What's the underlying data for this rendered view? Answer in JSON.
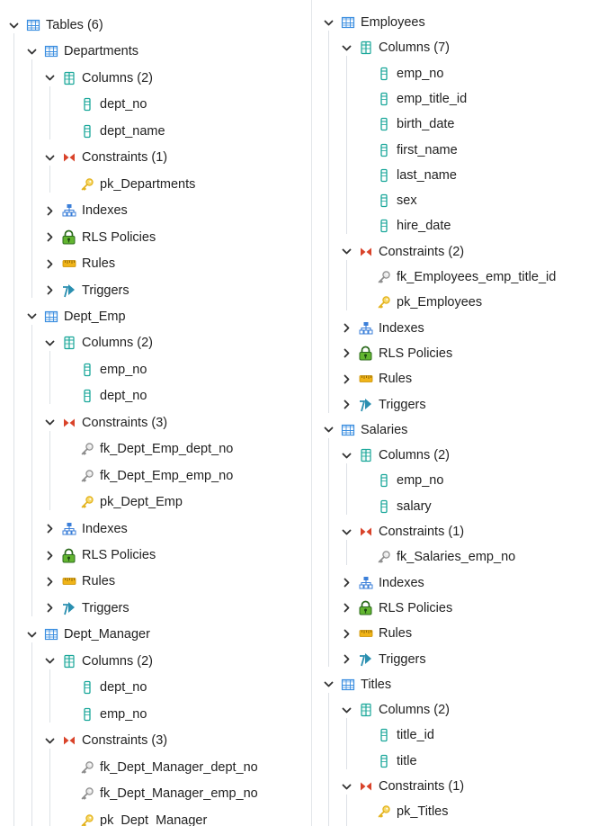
{
  "icon_colors": {
    "table": "#3b8ee0",
    "column": "#1aa79a",
    "constraint": "#d9432a",
    "pk_key": "#e3b21c",
    "fk_key": "#8c8c8c",
    "index": "#3b7fd9",
    "rls": "#3a9a28",
    "rules": "#f0b419",
    "triggers": "#2a8fb0"
  },
  "left": [
    {
      "label": "Tables (6)",
      "level": 0,
      "icon": "table",
      "chevron": "down"
    },
    {
      "label": "Departments",
      "level": 1,
      "icon": "table",
      "chevron": "down"
    },
    {
      "label": "Columns (2)",
      "level": 2,
      "icon": "columns",
      "chevron": "down"
    },
    {
      "label": "dept_no",
      "level": 3,
      "icon": "column",
      "chevron": "none"
    },
    {
      "label": "dept_name",
      "level": 3,
      "icon": "column",
      "chevron": "none"
    },
    {
      "label": "Constraints (1)",
      "level": 2,
      "icon": "constraints",
      "chevron": "down"
    },
    {
      "label": "pk_Departments",
      "level": 3,
      "icon": "pk",
      "chevron": "none"
    },
    {
      "label": "Indexes",
      "level": 2,
      "icon": "indexes",
      "chevron": "right"
    },
    {
      "label": "RLS Policies",
      "level": 2,
      "icon": "rls",
      "chevron": "right"
    },
    {
      "label": "Rules",
      "level": 2,
      "icon": "rules",
      "chevron": "right"
    },
    {
      "label": "Triggers",
      "level": 2,
      "icon": "triggers",
      "chevron": "right"
    },
    {
      "label": "Dept_Emp",
      "level": 1,
      "icon": "table",
      "chevron": "down"
    },
    {
      "label": "Columns (2)",
      "level": 2,
      "icon": "columns",
      "chevron": "down"
    },
    {
      "label": "emp_no",
      "level": 3,
      "icon": "column",
      "chevron": "none"
    },
    {
      "label": "dept_no",
      "level": 3,
      "icon": "column",
      "chevron": "none"
    },
    {
      "label": "Constraints (3)",
      "level": 2,
      "icon": "constraints",
      "chevron": "down"
    },
    {
      "label": "fk_Dept_Emp_dept_no",
      "level": 3,
      "icon": "fk",
      "chevron": "none"
    },
    {
      "label": "fk_Dept_Emp_emp_no",
      "level": 3,
      "icon": "fk",
      "chevron": "none"
    },
    {
      "label": "pk_Dept_Emp",
      "level": 3,
      "icon": "pk",
      "chevron": "none"
    },
    {
      "label": "Indexes",
      "level": 2,
      "icon": "indexes",
      "chevron": "right"
    },
    {
      "label": "RLS Policies",
      "level": 2,
      "icon": "rls",
      "chevron": "right"
    },
    {
      "label": "Rules",
      "level": 2,
      "icon": "rules",
      "chevron": "right"
    },
    {
      "label": "Triggers",
      "level": 2,
      "icon": "triggers",
      "chevron": "right"
    },
    {
      "label": "Dept_Manager",
      "level": 1,
      "icon": "table",
      "chevron": "down"
    },
    {
      "label": "Columns (2)",
      "level": 2,
      "icon": "columns",
      "chevron": "down"
    },
    {
      "label": "dept_no",
      "level": 3,
      "icon": "column",
      "chevron": "none"
    },
    {
      "label": "emp_no",
      "level": 3,
      "icon": "column",
      "chevron": "none"
    },
    {
      "label": "Constraints (3)",
      "level": 2,
      "icon": "constraints",
      "chevron": "down"
    },
    {
      "label": "fk_Dept_Manager_dept_no",
      "level": 3,
      "icon": "fk",
      "chevron": "none"
    },
    {
      "label": "fk_Dept_Manager_emp_no",
      "level": 3,
      "icon": "fk",
      "chevron": "none"
    },
    {
      "label": "pk_Dept_Manager",
      "level": 3,
      "icon": "pk",
      "chevron": "none"
    }
  ],
  "right": [
    {
      "label": "Employees",
      "level": 0,
      "icon": "table",
      "chevron": "down"
    },
    {
      "label": "Columns (7)",
      "level": 1,
      "icon": "columns",
      "chevron": "down"
    },
    {
      "label": "emp_no",
      "level": 2,
      "icon": "column",
      "chevron": "none"
    },
    {
      "label": "emp_title_id",
      "level": 2,
      "icon": "column",
      "chevron": "none"
    },
    {
      "label": "birth_date",
      "level": 2,
      "icon": "column",
      "chevron": "none"
    },
    {
      "label": "first_name",
      "level": 2,
      "icon": "column",
      "chevron": "none"
    },
    {
      "label": "last_name",
      "level": 2,
      "icon": "column",
      "chevron": "none"
    },
    {
      "label": "sex",
      "level": 2,
      "icon": "column",
      "chevron": "none"
    },
    {
      "label": "hire_date",
      "level": 2,
      "icon": "column",
      "chevron": "none"
    },
    {
      "label": "Constraints (2)",
      "level": 1,
      "icon": "constraints",
      "chevron": "down"
    },
    {
      "label": "fk_Employees_emp_title_id",
      "level": 2,
      "icon": "fk",
      "chevron": "none"
    },
    {
      "label": "pk_Employees",
      "level": 2,
      "icon": "pk",
      "chevron": "none"
    },
    {
      "label": "Indexes",
      "level": 1,
      "icon": "indexes",
      "chevron": "right"
    },
    {
      "label": "RLS Policies",
      "level": 1,
      "icon": "rls",
      "chevron": "right"
    },
    {
      "label": "Rules",
      "level": 1,
      "icon": "rules",
      "chevron": "right"
    },
    {
      "label": "Triggers",
      "level": 1,
      "icon": "triggers",
      "chevron": "right"
    },
    {
      "label": "Salaries",
      "level": 0,
      "icon": "table",
      "chevron": "down"
    },
    {
      "label": "Columns (2)",
      "level": 1,
      "icon": "columns",
      "chevron": "down"
    },
    {
      "label": "emp_no",
      "level": 2,
      "icon": "column",
      "chevron": "none"
    },
    {
      "label": "salary",
      "level": 2,
      "icon": "column",
      "chevron": "none"
    },
    {
      "label": "Constraints (1)",
      "level": 1,
      "icon": "constraints",
      "chevron": "down"
    },
    {
      "label": "fk_Salaries_emp_no",
      "level": 2,
      "icon": "fk",
      "chevron": "none"
    },
    {
      "label": "Indexes",
      "level": 1,
      "icon": "indexes",
      "chevron": "right"
    },
    {
      "label": "RLS Policies",
      "level": 1,
      "icon": "rls",
      "chevron": "right"
    },
    {
      "label": "Rules",
      "level": 1,
      "icon": "rules",
      "chevron": "right"
    },
    {
      "label": "Triggers",
      "level": 1,
      "icon": "triggers",
      "chevron": "right"
    },
    {
      "label": "Titles",
      "level": 0,
      "icon": "table",
      "chevron": "down"
    },
    {
      "label": "Columns (2)",
      "level": 1,
      "icon": "columns",
      "chevron": "down"
    },
    {
      "label": "title_id",
      "level": 2,
      "icon": "column",
      "chevron": "none"
    },
    {
      "label": "title",
      "level": 2,
      "icon": "column",
      "chevron": "none"
    },
    {
      "label": "Constraints (1)",
      "level": 1,
      "icon": "constraints",
      "chevron": "down"
    },
    {
      "label": "pk_Titles",
      "level": 2,
      "icon": "pk",
      "chevron": "none"
    }
  ]
}
